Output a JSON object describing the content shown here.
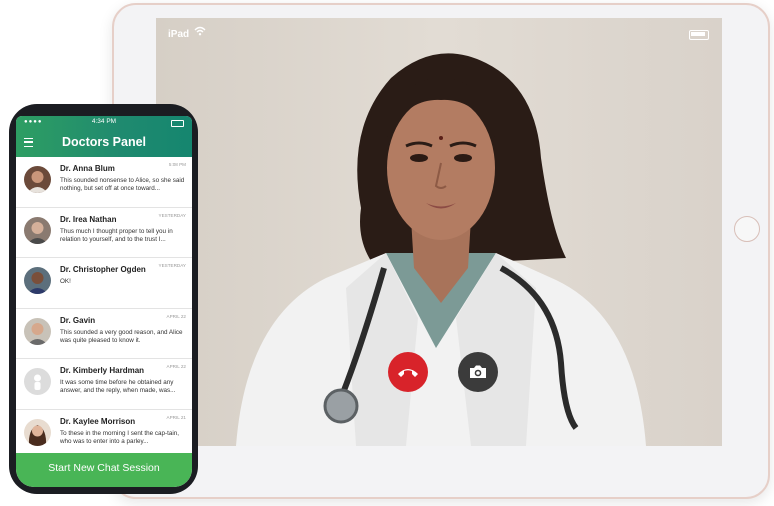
{
  "ipad": {
    "carrier": "iPad",
    "wifi_icon": "wifi-icon",
    "battery_icon": "battery-icon",
    "call_controls": {
      "end_call_icon": "phone-hangup-icon",
      "camera_icon": "camera-icon",
      "end_call_color": "#d8232a",
      "camera_color": "#3b3b3b"
    }
  },
  "phone": {
    "status_time": "4:34 PM",
    "title": "Doctors Panel",
    "accent_color": "#2e9e63",
    "chats": [
      {
        "name": "Dr. Anna Blum",
        "time": "5:08 PM",
        "message": "This sounded nonsense to Alice, so she said nothing, but set off at once toward..."
      },
      {
        "name": "Dr. Irea Nathan",
        "time": "Yesterday",
        "message": "Thus much I thought proper to tell you in relation to yourself, and to the trust I..."
      },
      {
        "name": "Dr. Christopher Ogden",
        "time": "Yesterday",
        "message": "OK!"
      },
      {
        "name": "Dr. Gavin",
        "time": "April 22",
        "message": "This sounded a very good reason, and Alice was quite pleased to know it."
      },
      {
        "name": "Dr. Kimberly Hardman",
        "time": "April 22",
        "message": "It was some time before he obtained any answer, and the reply, when made, was..."
      },
      {
        "name": "Dr. Kaylee Morrison",
        "time": "April 21",
        "message": "To these in the morning I sent the cap-tain, who was to enter into a parley..."
      }
    ],
    "new_chat_label": "Start New Chat Session"
  }
}
